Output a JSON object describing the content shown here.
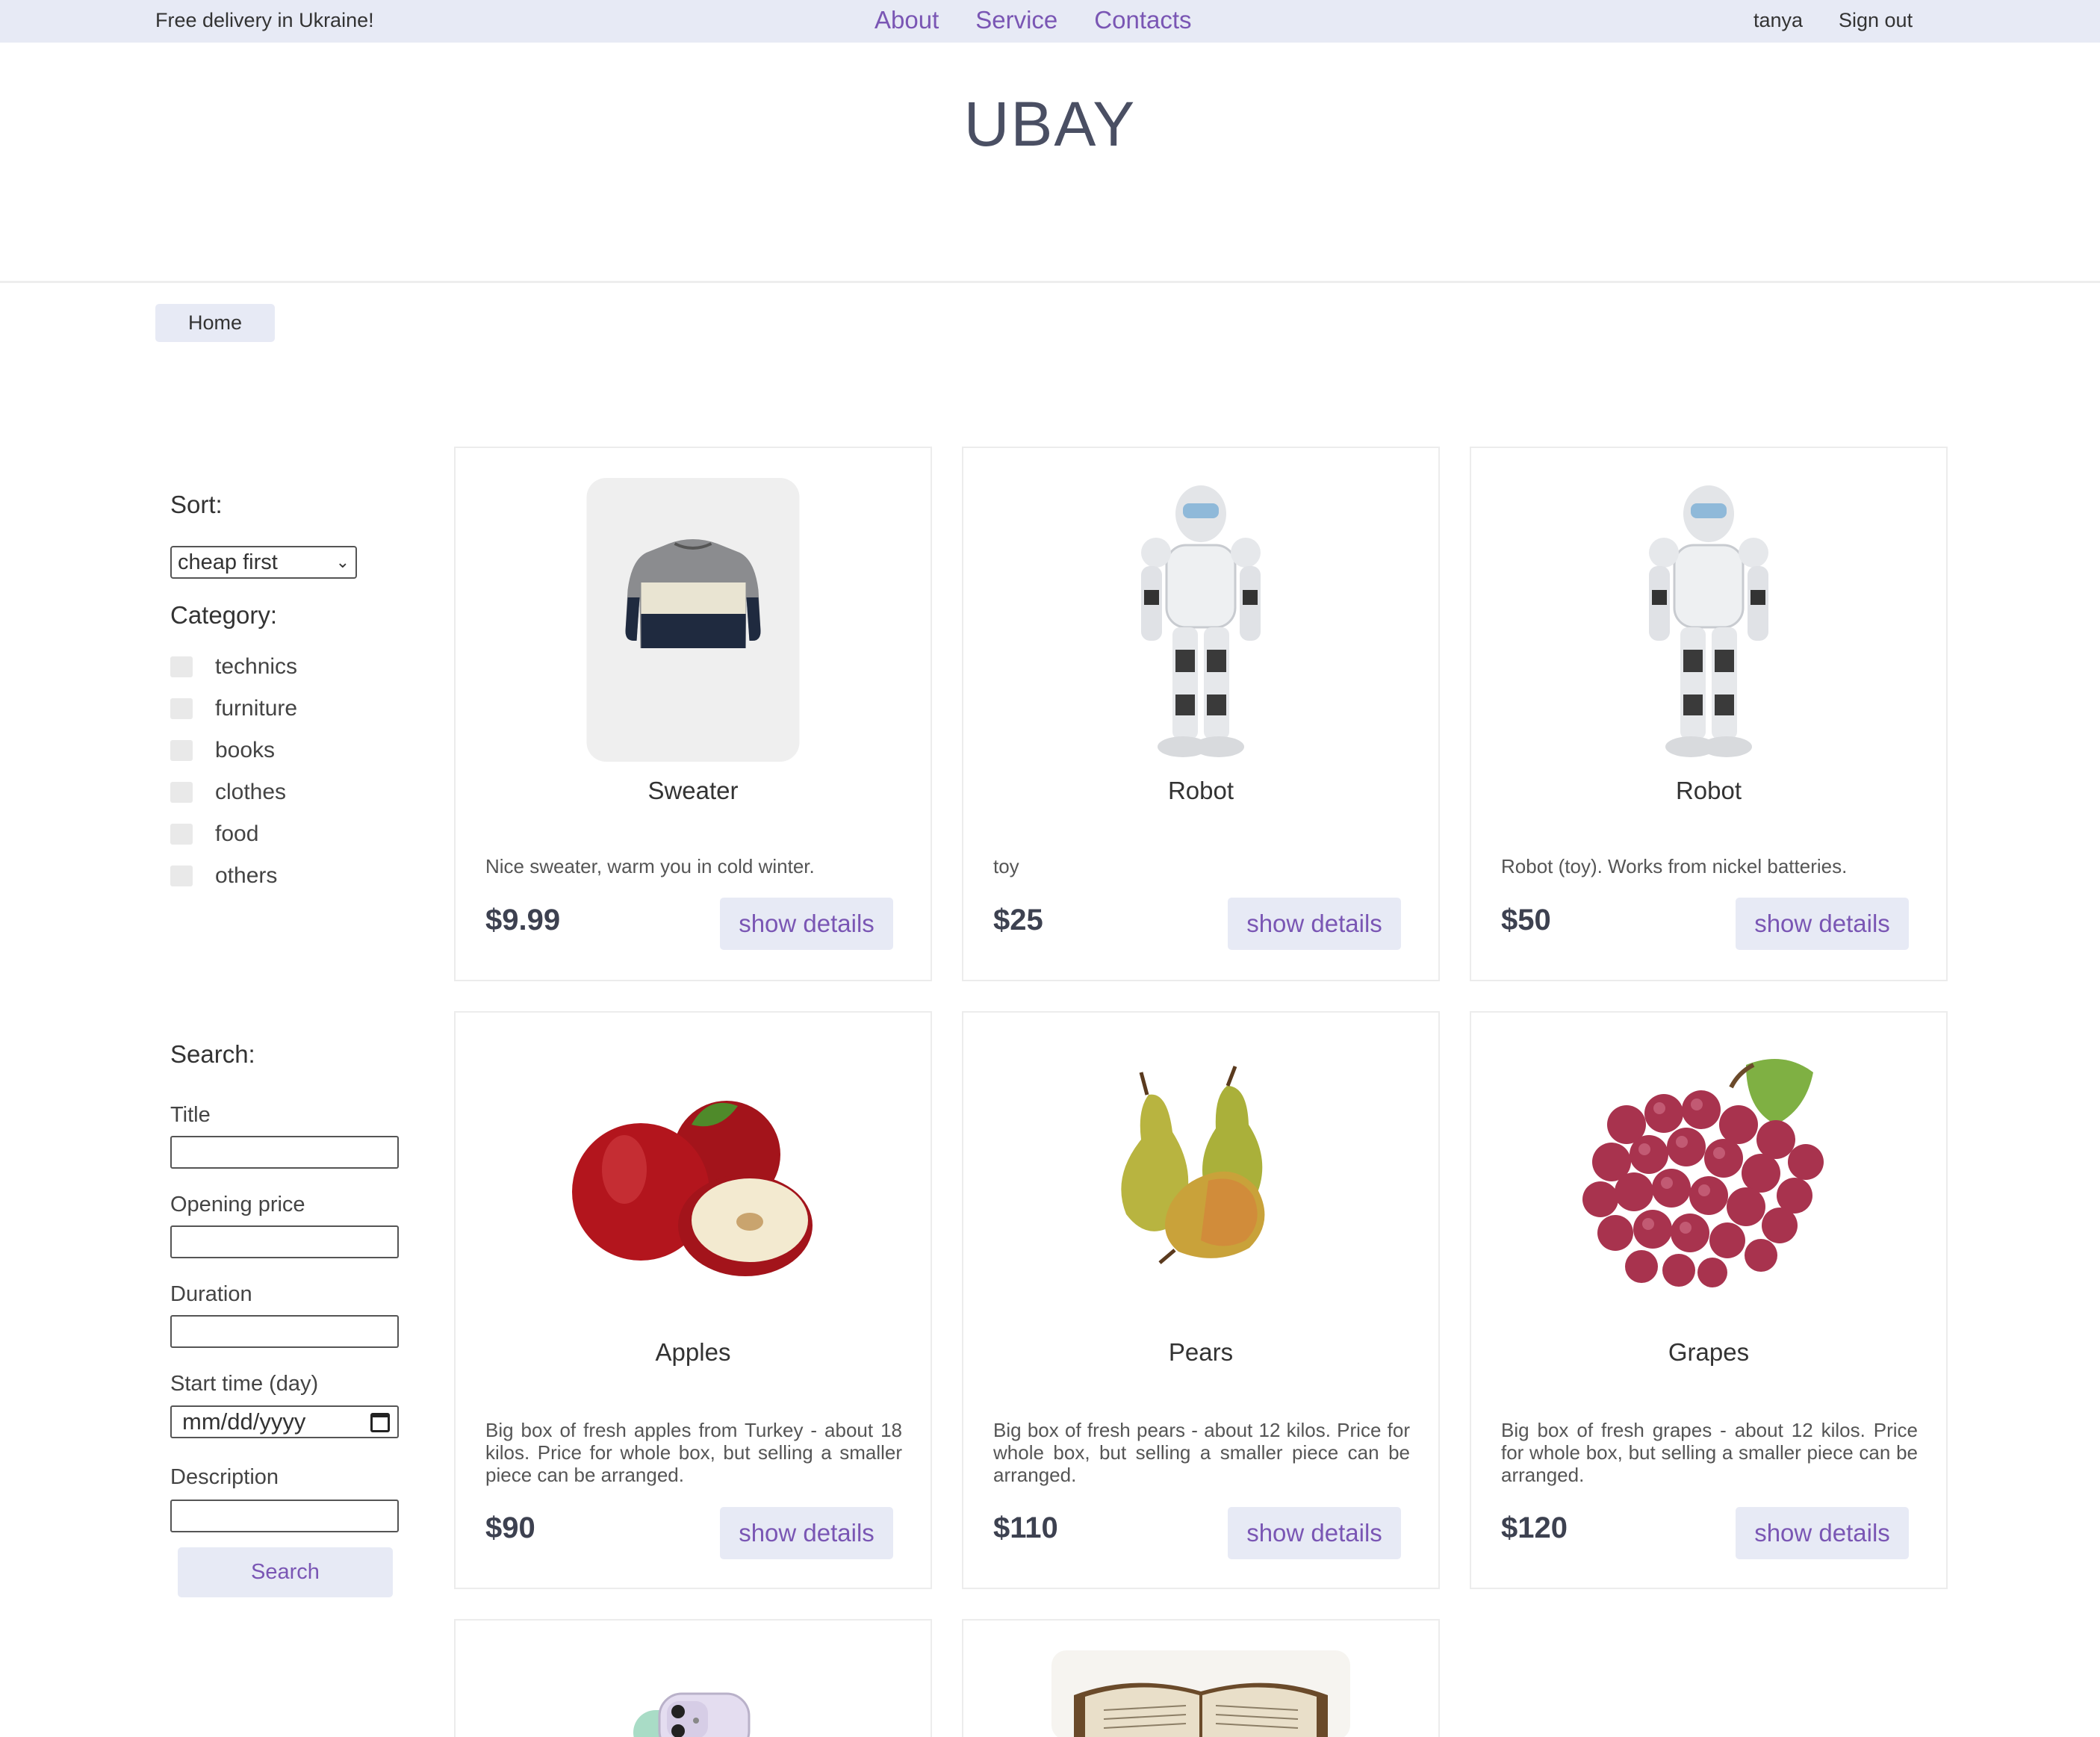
{
  "topbar": {
    "promo": "Free delivery in Ukraine!",
    "nav": [
      "About",
      "Service",
      "Contacts"
    ],
    "user": "tanya",
    "signout": "Sign out"
  },
  "logo": "UBAY",
  "breadcrumb": {
    "home": "Home"
  },
  "sidebar": {
    "sort_heading": "Sort:",
    "sort_value": "cheap first",
    "category_heading": "Category:",
    "categories": [
      "technics",
      "furniture",
      "books",
      "clothes",
      "food",
      "others"
    ],
    "search_heading": "Search:",
    "fields": {
      "title": "Title",
      "opening_price": "Opening price",
      "duration": "Duration",
      "start_time": "Start time (day)",
      "start_time_placeholder": "mm/dd/yyyy",
      "description": "Description"
    },
    "search_button": "Search"
  },
  "products": [
    {
      "title": "Sweater",
      "desc": "Nice sweater, warm you in cold winter.",
      "price": "$9.99",
      "button": "show details",
      "icon": "sweater-image"
    },
    {
      "title": "Robot",
      "desc": "toy",
      "price": "$25",
      "button": "show details",
      "icon": "robot-image"
    },
    {
      "title": "Robot",
      "desc": "Robot (toy). Works from nickel batteries.",
      "price": "$50",
      "button": "show details",
      "icon": "robot-image"
    },
    {
      "title": "Apples",
      "desc": "Big box of fresh apples from Turkey - about 18 kilos. Price for whole box, but selling a smaller piece can be arranged.",
      "price": "$90",
      "button": "show details",
      "icon": "apples-image"
    },
    {
      "title": "Pears",
      "desc": "Big box of fresh pears - about 12 kilos. Price for whole box, but selling a smaller piece can be arranged.",
      "price": "$110",
      "button": "show details",
      "icon": "pears-image"
    },
    {
      "title": "Grapes",
      "desc": "Big box of fresh grapes - about 12 kilos. Price for whole box, but selling a smaller piece can be arranged.",
      "price": "$120",
      "button": "show details",
      "icon": "grapes-image"
    }
  ],
  "colors": {
    "accent": "#7a56b4",
    "bar": "#e7eaf5",
    "price": "#3d4150"
  }
}
